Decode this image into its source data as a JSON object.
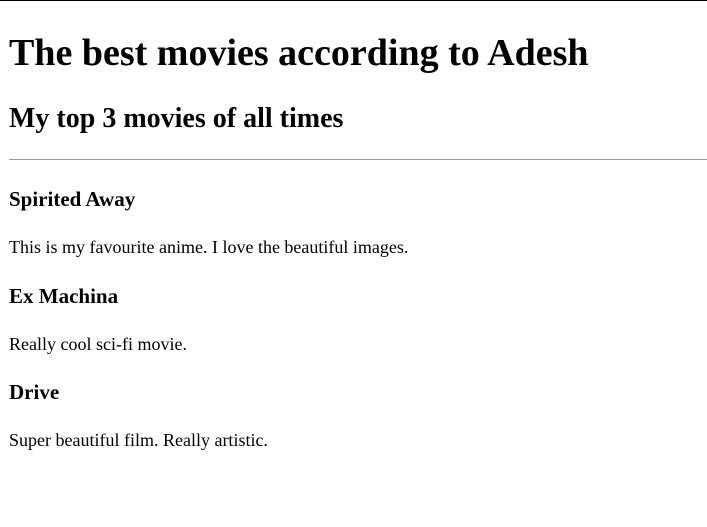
{
  "page": {
    "heading": "The best movies according to Adesh",
    "subheading": "My top 3 movies of all times"
  },
  "movies": [
    {
      "title": "Spirited Away",
      "description": "This is my favourite anime. I love the beautiful images."
    },
    {
      "title": "Ex Machina",
      "description": "Really cool sci-fi movie."
    },
    {
      "title": "Drive",
      "description": "Super beautiful film. Really artistic."
    }
  ],
  "colors": {
    "text": "#000000",
    "background": "#ffffff",
    "divider": "#9a9a9a"
  }
}
